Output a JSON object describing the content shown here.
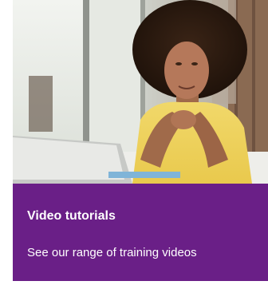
{
  "card": {
    "title": "Video tutorials",
    "description": "See our range of training videos",
    "accent_color": "#6a1f87",
    "image_alt": "woman-using-laptop-photo"
  }
}
